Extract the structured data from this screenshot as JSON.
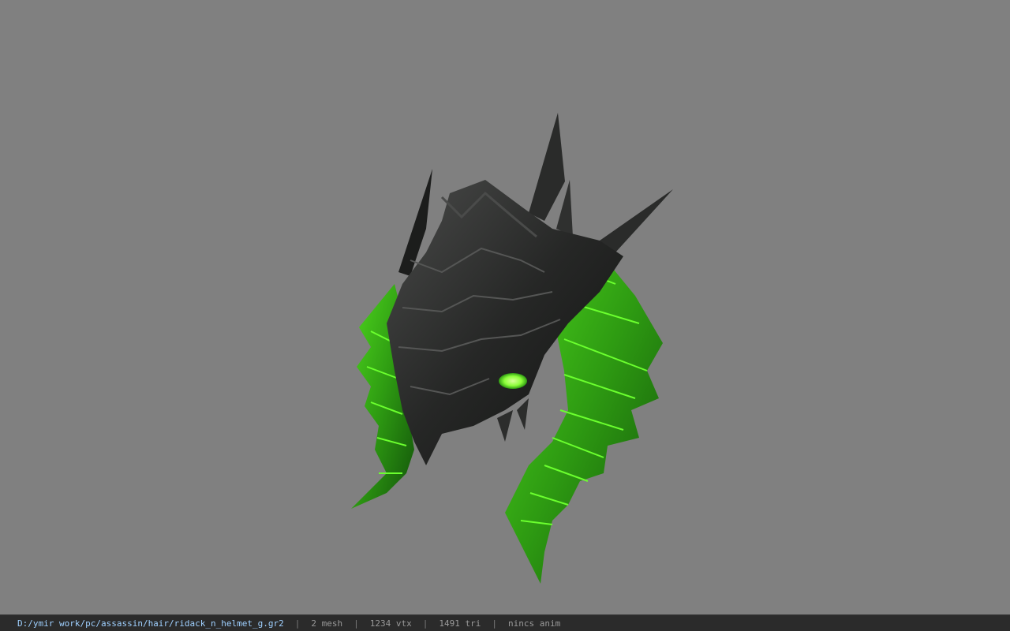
{
  "viewport": {
    "background_color": "#808080",
    "model": {
      "name": "dragon-helmet-model",
      "colors": {
        "armor_dark": "#1e1f1e",
        "armor_mid": "#3a3b3a",
        "scale_green": "#2e9b12",
        "scale_green_light": "#4fd81e",
        "scale_green_dark": "#12520a",
        "eye_glow": "#8cff3a"
      }
    }
  },
  "status_bar": {
    "file_path": "D:/ymir work/pc/assassin/hair/ridack_n_helmet_g.gr2",
    "separator": "|",
    "mesh_count": "2 mesh",
    "vertex_count": "1234 vtx",
    "triangle_count": "1491 tri",
    "anim_status": "nincs anim",
    "background_color": "#2b2b2b",
    "path_color": "#9fd0ff"
  }
}
